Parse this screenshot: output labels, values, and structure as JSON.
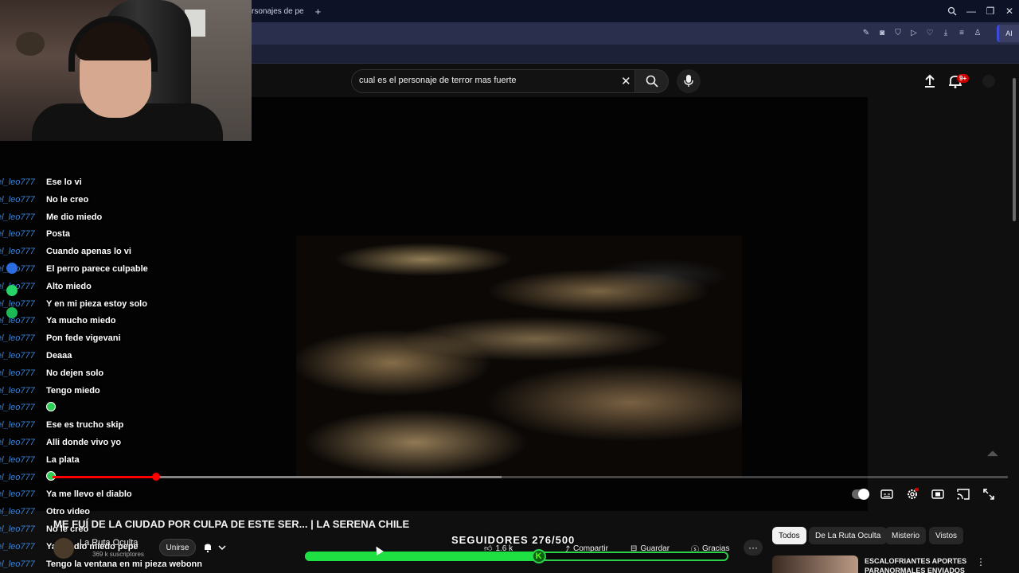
{
  "browser": {
    "tab_title": "rsonajes de pe",
    "new_tab_symbol": "+",
    "ai_label": "AI",
    "window_controls": [
      "⌕",
      "—",
      "❐",
      "✕"
    ]
  },
  "header": {
    "search_value": "cual es el personaje de terror mas fuerte",
    "notification_count": "9+"
  },
  "chat": {
    "username": "el_leo777",
    "messages": [
      "Ese lo vi",
      "No le creo",
      "Me dio miedo",
      "Posta",
      "Cuando apenas lo vi",
      "El perro parece culpable",
      "Alto miedo",
      "Y en mi pieza estoy solo",
      "Ya mucho miedo",
      "Pon fede vigevani",
      "Deaaa",
      "No dejen solo",
      "Tengo miedo",
      "",
      "Ese es trucho skip",
      "Alli donde vivo yo",
      "La plata",
      "",
      "Ya me llevo el diablo",
      "Otro video",
      "No le creo",
      "Ya me dio miedo pepe",
      "Tengo la ventana en mi pieza webonn"
    ]
  },
  "video": {
    "title": "ME FUÍ DE LA CIUDAD POR CULPA DE ESTE SER... | LA SERENA CHILE",
    "progress_fraction": 0.108,
    "buffered_fraction": 0.47
  },
  "channel": {
    "name": "La Ruta Oculta",
    "subscribers": "369 k suscriptores",
    "join_label": "Unirse"
  },
  "actions": {
    "likes": "1.6 k",
    "share": "Compartir",
    "save": "Guardar",
    "thanks": "Gracias",
    "more": "···"
  },
  "overlay": {
    "goal_label": "SEGUIDORES 276/500",
    "goal_current": 276,
    "goal_target": 500,
    "goal_icon_letter": "K",
    "goal_color": "#1fe043"
  },
  "filters": {
    "chips": [
      "Todos",
      "De La Ruta Oculta",
      "Misterio",
      "Vistos"
    ]
  },
  "recommendation": {
    "title": "ESCALOFRIANTES APORTES PARANORMALES ENVIADOS"
  },
  "colors": {
    "chat_username": "#3b82d6",
    "progress": "#ff0000",
    "notification_badge": "#cc0000"
  }
}
